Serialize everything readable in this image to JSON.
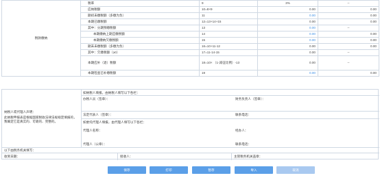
{
  "rows": [
    {
      "label": "税率",
      "formula": "9",
      "v1": "3%",
      "v2": "--",
      "indent": "1",
      "blue": false
    },
    {
      "label": "应纳税额",
      "formula": "10=8×9",
      "v1": "0.00",
      "v2": "0.00",
      "indent": "1",
      "blue": false
    },
    {
      "label": "期初未缴税额（多缴为负）",
      "formula": "11",
      "v1": "0.00",
      "v2": "0.00",
      "indent": "1",
      "blue": true
    },
    {
      "label": "本期已缴税额",
      "formula": "12=13+14+15",
      "v1": "0.00",
      "v2": "0.00",
      "indent": "1",
      "blue": false
    },
    {
      "label": "其中：分期预缴税额",
      "formula": "13",
      "v1": "0.00",
      "v2": "--",
      "indent": "1",
      "blue": true
    },
    {
      "label": "本期缴纳上期应缴税额",
      "formula": "14",
      "v1": "0.00",
      "v2": "0.00",
      "indent": "2",
      "blue": true
    },
    {
      "label": "本期缴纳欠缴税额",
      "formula": "15",
      "v1": "0.00",
      "v2": "0.00",
      "indent": "2",
      "blue": true
    },
    {
      "label": "期末未缴税额（多缴为负）",
      "formula": "16=10+11-12",
      "v1": "0.00",
      "v2": "0.00",
      "indent": "1",
      "blue": false
    },
    {
      "label": "其中：欠缴税额（≥0）",
      "formula": "17=11-14-15",
      "v1": "0.00",
      "v2": "--",
      "indent": "1",
      "blue": false
    },
    {
      "label": "本期应补（退）税额",
      "formula": "18=10× （1-减征比例）-13",
      "v1": "0.00",
      "v2": "--",
      "indent": "1",
      "blue": false,
      "tall": true
    },
    {
      "label": "本期检查已补缴税额",
      "formula": "19",
      "v1": "0.00",
      "v2": "0.00",
      "indent": "1",
      "blue": true
    }
  ],
  "section_label": "税款缴纳",
  "declaration": {
    "title": "纳税人或代理人声明：",
    "text": "此纳税申报表是根据国家税收法律法规规定填报的，我确定它是真实的、可靠的、完整的。",
    "taxpayer_fill": "如纳税人填报，由纳税人填写以下各栏：",
    "handler": "办税人员（签章）：",
    "finance": "财务负责人（签章）：",
    "legal_rep": "法定代表人（签章）：",
    "phone": "联系电话：",
    "agent_fill": "如委托代理人填报，由代理人填写以下各栏：",
    "agent_name": "代理人名称：",
    "agent_person": "经办人：",
    "agent_seal": "代理人（公章）：",
    "agent_phone": "联系电话："
  },
  "tax_office": {
    "title": "以下由税务机关填写：",
    "receive_date": "收到日期：",
    "receiver": "接收人：",
    "auth_code": "主管税务机关盖章："
  },
  "buttons": {
    "save": "保存",
    "print": "打印",
    "temp_save": "暂存",
    "import": "导入",
    "cancel": "取消"
  }
}
